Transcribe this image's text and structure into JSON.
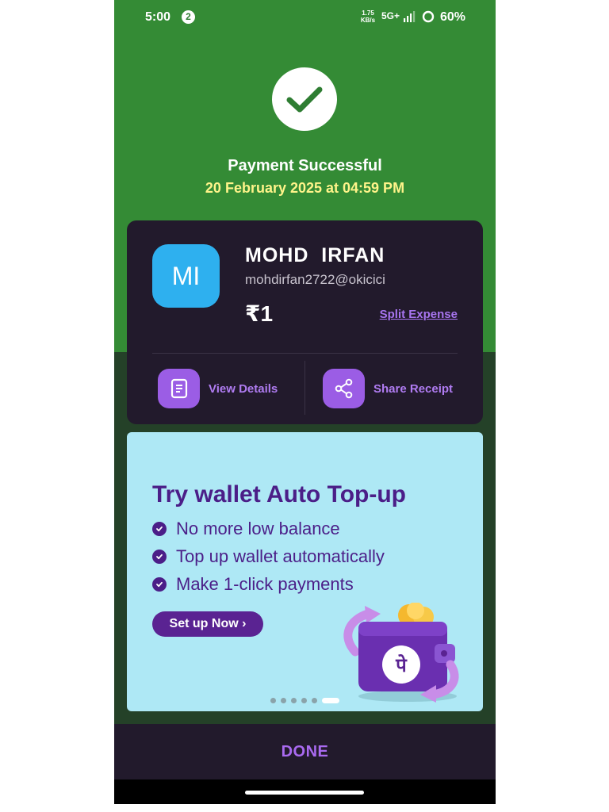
{
  "status_bar": {
    "time": "5:00",
    "notification_count": "2",
    "net_speed_value": "1.75",
    "net_speed_unit": "KB/s",
    "network": "5G+",
    "battery": "60%"
  },
  "header": {
    "title": "Payment Successful",
    "datetime": "20 February 2025 at 04:59 PM"
  },
  "payee": {
    "initials": "MI",
    "name": "MOHD  IRFAN",
    "upi_id": "mohdirfan2722@okicici",
    "amount": "₹1",
    "split_label": "Split Expense"
  },
  "actions": {
    "view_details": "View Details",
    "share_receipt": "Share Receipt"
  },
  "promo": {
    "title": "Try wallet Auto Top-up",
    "bullets": [
      "No more low balance",
      "Top up wallet automatically",
      "Make 1-click payments"
    ],
    "cta": "Set up Now ›",
    "wallet_glyph": "पे",
    "carousel_total": 6,
    "carousel_active": 6
  },
  "footer": {
    "done_label": "DONE"
  },
  "colors": {
    "success_green": "#348b35",
    "card_bg": "#221a2c",
    "accent_purple": "#a875f0",
    "promo_bg": "#aee8f5",
    "promo_text": "#4b1e88",
    "date_yellow": "#fff48a"
  }
}
